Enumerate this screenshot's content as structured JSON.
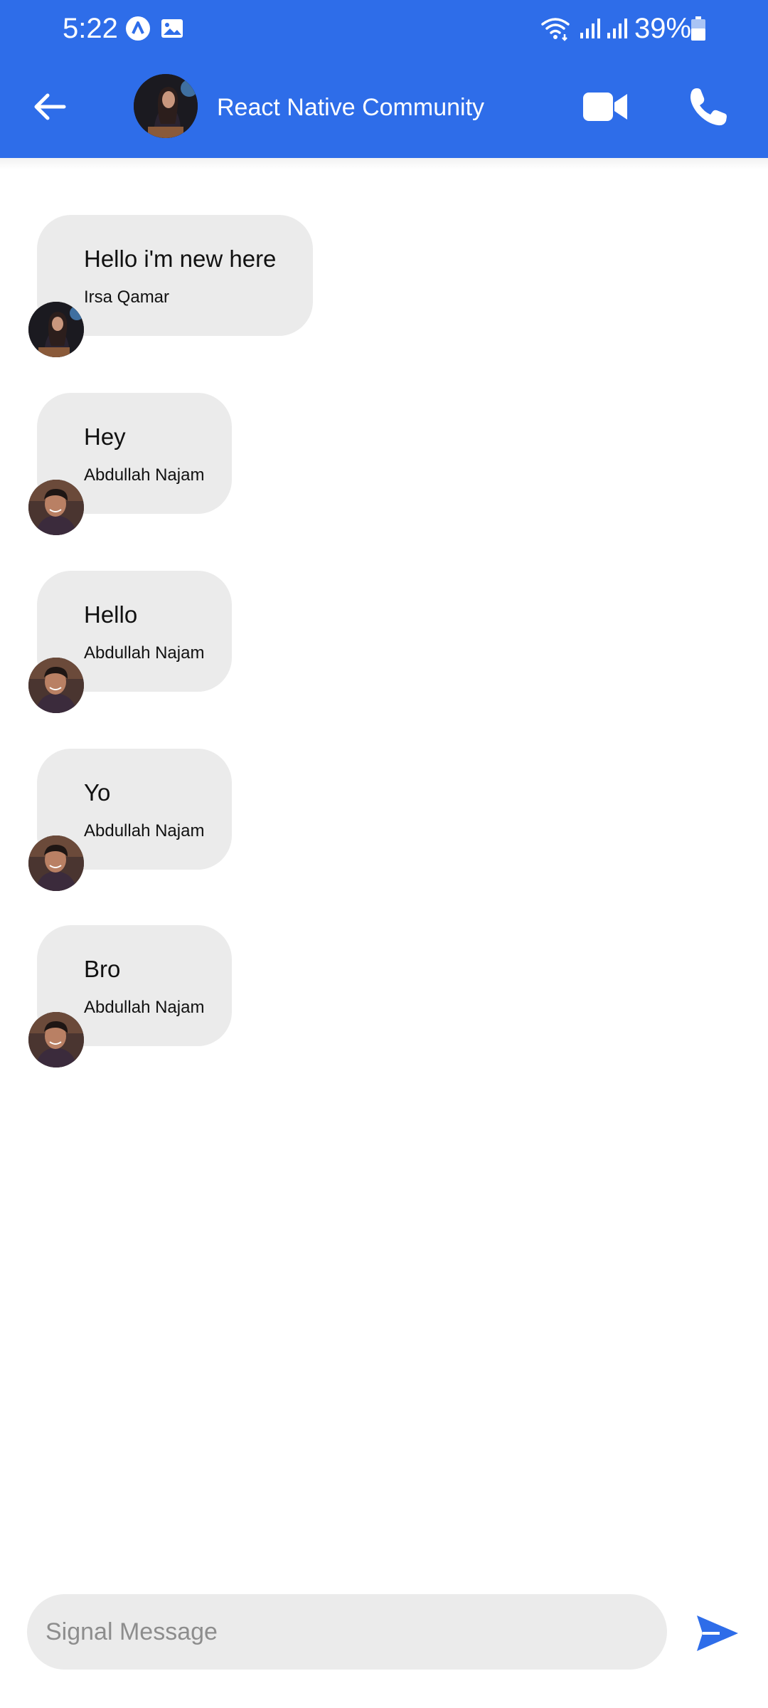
{
  "status_bar": {
    "time": "5:22",
    "battery": "39%",
    "icons": [
      "autofill-a-icon",
      "gallery-icon",
      "wifi-icon",
      "signal-icon",
      "signal-icon",
      "battery-icon"
    ]
  },
  "header": {
    "title": "React Native Community",
    "back_icon": "arrow-left-icon",
    "video_icon": "video-camera-icon",
    "call_icon": "phone-icon",
    "background": "#2e6de9"
  },
  "messages": [
    {
      "text": "Hello i'm new here",
      "author": "Irsa Qamar"
    },
    {
      "text": "Hey",
      "author": "Abdullah Najam"
    },
    {
      "text": "Hello",
      "author": "Abdullah Najam"
    },
    {
      "text": "Yo",
      "author": "Abdullah Najam"
    },
    {
      "text": "Bro",
      "author": "Abdullah Najam"
    }
  ],
  "composer": {
    "placeholder": "Signal Message",
    "value": "",
    "send_icon": "send-icon"
  },
  "colors": {
    "accent": "#2e6de9",
    "bubble": "#ebebeb",
    "input": "#ebebeb"
  }
}
